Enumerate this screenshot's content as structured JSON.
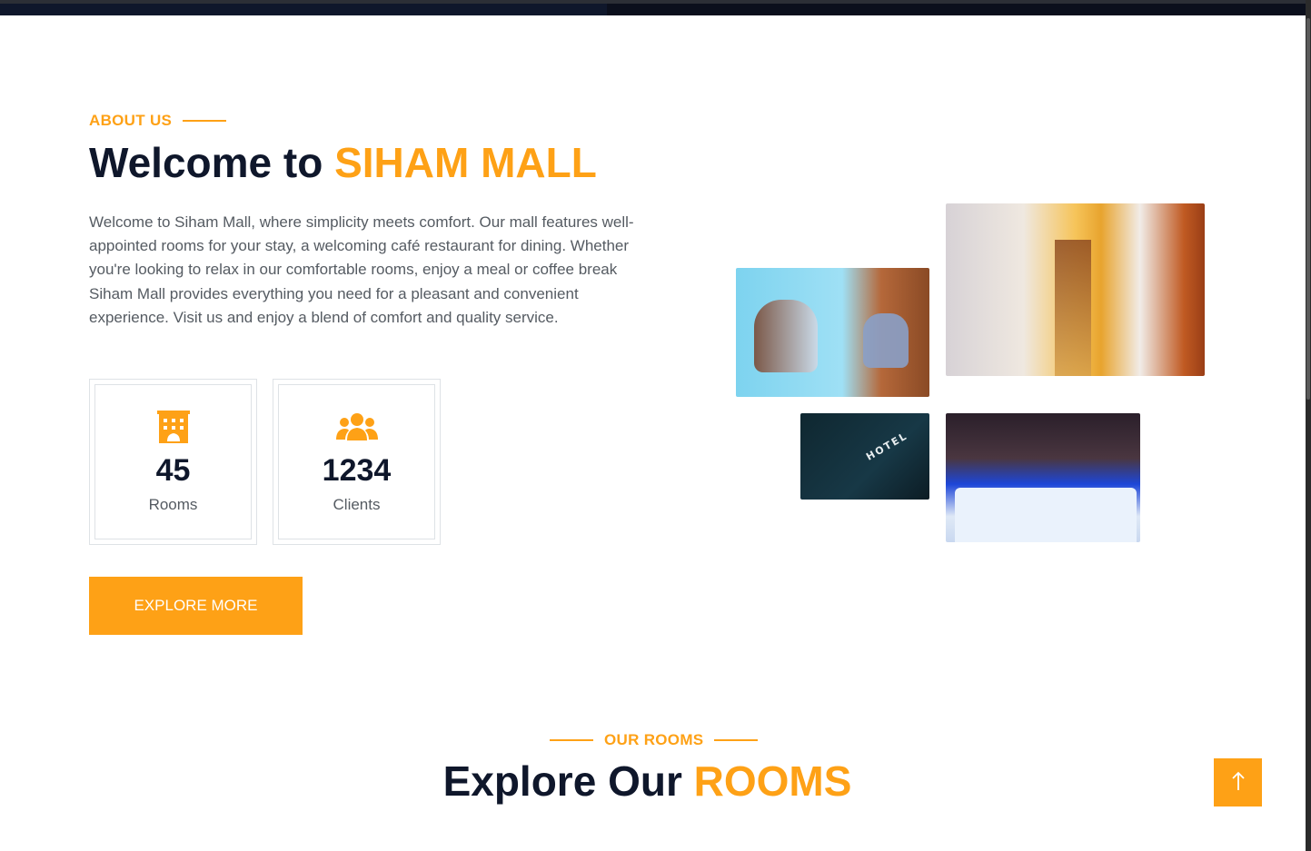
{
  "about": {
    "subtitle": "ABOUT US",
    "title_prefix": "Welcome to ",
    "title_accent": "SIHAM MALL",
    "description": "Welcome to Siham Mall, where simplicity meets comfort. Our mall features well-appointed rooms for your stay, a welcoming café restaurant for dining. Whether you're looking to relax in our comfortable rooms, enjoy a meal or coffee break Siham Mall provides everything you need for a pleasant and convenient experience. Visit us and enjoy a blend of comfort and quality service.",
    "stats": [
      {
        "icon": "hotel-icon",
        "value": "45",
        "label": "Rooms"
      },
      {
        "icon": "users-icon",
        "value": "1234",
        "label": "Clients"
      }
    ],
    "button_label": "EXPLORE MORE"
  },
  "gallery": {
    "images": [
      "cafe-table-photo",
      "hallway-photo",
      "hotel-sign-photo",
      "bedroom-photo"
    ],
    "hotel_sign_text": "HOTEL"
  },
  "rooms": {
    "subtitle": "OUR ROOMS",
    "title_prefix": "Explore Our ",
    "title_accent": "ROOMS"
  },
  "back_to_top_icon": "arrow-up-icon",
  "colors": {
    "accent": "#fea116",
    "dark": "#0f172b",
    "text": "#555b62"
  }
}
